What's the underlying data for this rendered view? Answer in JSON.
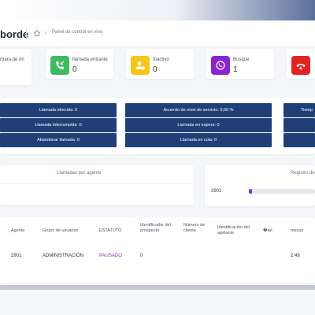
{
  "header": {
    "logo_text": "borde",
    "breadcrumb": "Panel de control en vivo"
  },
  "stats": {
    "first_label": "rbara de ón",
    "items": [
      {
        "label": "llamada entrante",
        "value": "0",
        "color": "#3dbb5e",
        "icon": "phone-incoming-icon"
      },
      {
        "label": "Inactivo",
        "value": "0",
        "color": "#f5c518",
        "icon": "user-idle-icon"
      },
      {
        "label": "Busque",
        "value": "1",
        "color": "#8a26c9",
        "icon": "phone-busy-icon"
      },
      {
        "label": "",
        "value": "",
        "color": "#e02424",
        "icon": "phone-hangup-icon"
      }
    ]
  },
  "bars": {
    "offered": "Llamada ofrecida: 0",
    "interrupted": "Llamada interrumpida :0",
    "abandon": "Abandonar llamada :0",
    "sla": "Acuerdo de nivel de servicio: 0,00 %",
    "on_hold": "Llamada en espera: 0",
    "in_queue": "Llamada en cola: 0",
    "right_partial": "Tiemp"
  },
  "panels": {
    "calls_per_agent": "Llamadas por agente",
    "log_partial": "Registro de"
  },
  "progress": {
    "agent": "2901",
    "fraction": 0.05
  },
  "table": {
    "headers": [
      "Agente",
      "Grupo de usuarios",
      "ESTATUTO",
      "Identificador del prospecto",
      "Número de cliente",
      "Identificación del apelante",
      "�tat",
      "mecas"
    ],
    "row": [
      "2901",
      "ADMINISTRACIÓN",
      "PAUSADO",
      "0",
      "",
      "",
      "",
      "2:48"
    ]
  },
  "colors": {
    "bar_blue": "#1f3f78",
    "status_purple": "#9b2fc0"
  }
}
